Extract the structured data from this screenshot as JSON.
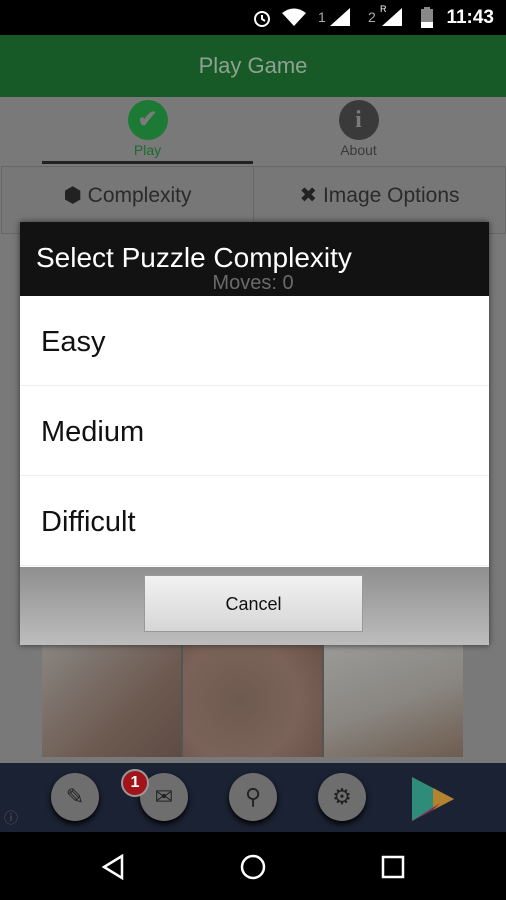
{
  "status_bar": {
    "time": "11:43",
    "sim1": "1",
    "sim2": "2",
    "roaming": "R"
  },
  "app_bar": {
    "title": "Play Game"
  },
  "tabs": [
    {
      "label": "Play",
      "icon": "check-circle-icon",
      "selected": true
    },
    {
      "label": "About",
      "icon": "info-icon",
      "selected": false
    }
  ],
  "option_buttons": [
    {
      "label": "Complexity",
      "icon": "cube-icon"
    },
    {
      "label": "Image Options",
      "icon": "tools-icon"
    }
  ],
  "moves_label": "Moves: 0",
  "dialog": {
    "title": "Select Puzzle Complexity",
    "options": [
      "Easy",
      "Medium",
      "Difficult"
    ],
    "cancel_label": "Cancel"
  },
  "ad_bar": {
    "badge_count": "1",
    "icons": [
      "edit-icon",
      "mail-icon",
      "search-icon",
      "gear-icon",
      "play-store-icon"
    ]
  },
  "colors": {
    "app_bar": "#1e7a35",
    "accent": "#2e9a45"
  }
}
